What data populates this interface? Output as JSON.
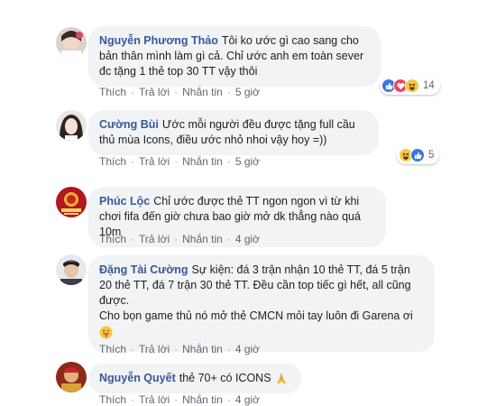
{
  "comments": [
    {
      "author": "Nguyễn Phương Thảo",
      "text": "Tôi ko ước gì cao sang cho bản thân mình làm gì cả. Chỉ ước anh em toàn sever đc tặng 1 thẻ top 30 TT vậy thôi",
      "like": "Thích",
      "reply": "Trả lời",
      "message": "Nhắn tin",
      "time": "5 giờ",
      "reaction_count": "14"
    },
    {
      "author": "Cường Bùi",
      "text": "Ước mỗi người đều được tặng full cầu thủ mùa Icons, điều ước nhỏ nhoi vậy hoy =))",
      "like": "Thích",
      "reply": "Trả lời",
      "message": "Nhắn tin",
      "time": "5 giờ",
      "reaction_count": "5"
    },
    {
      "author": "Phúc Lộc",
      "text": "Chỉ ước được thẻ TT ngon ngon vì từ khi chơi fifa đến giờ chưa bao giờ mở dk thẳng nào quá 10m",
      "like": "Thích",
      "reply": "Trả lời",
      "message": "Nhắn tin",
      "time": "4 giờ"
    },
    {
      "author": "Đặng Tài Cường",
      "text": "Sự kiện: đá 3 trận nhận 10 thẻ TT, đá 5 trận 20 thẻ TT, đá 7 trận 30 thẻ TT. Đều cần top tiếc gì hết, all cũng được.",
      "text2": "Cho bọn game thủ nó mở thẻ CMCN mỏi tay luôn đi Garena ơi",
      "like": "Thích",
      "reply": "Trả lời",
      "message": "Nhắn tin",
      "time": "4 giờ"
    },
    {
      "author": "Nguyễn Quyết",
      "text": "thẻ 70+ có ICONS",
      "like": "Thích",
      "reply": "Trả lời",
      "message": "Nhắn tin",
      "time": "4 giờ"
    }
  ],
  "icons": {
    "like": "like-reaction-icon",
    "love": "love-reaction-icon",
    "haha": "haha-reaction-icon",
    "pray": "folded-hands-emoji",
    "tongue": "tongue-out-emoji"
  },
  "colors": {
    "name": "#385898",
    "bubble": "#f2f3f5",
    "meta": "#616770"
  }
}
